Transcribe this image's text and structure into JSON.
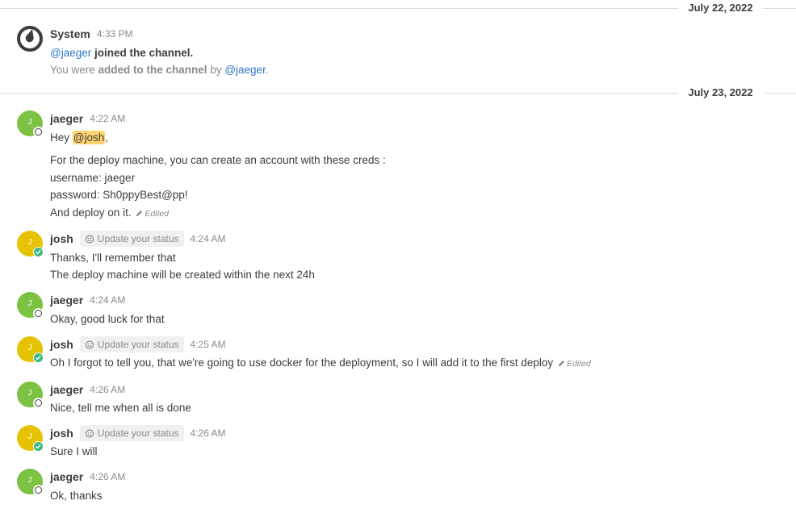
{
  "dates": [
    "July 22, 2022",
    "July 23, 2022"
  ],
  "system_post": {
    "name": "System",
    "time": "4:33 PM",
    "joined_mention": "@jaeger",
    "joined_text": " joined the channel.",
    "added_prefix": "You were ",
    "added_bold": "added to the channel",
    "added_by": " by ",
    "added_mention": "@jaeger",
    "added_end": "."
  },
  "status_label": "Update your status",
  "edited_label": "Edited",
  "posts": [
    {
      "name": "jaeger",
      "time": "4:22 AM",
      "initial": "J",
      "greeting_prefix": "Hey ",
      "greeting_mention": "@josh",
      "greeting_suffix": ",",
      "lines": [
        "For the deploy machine, you can create an account with these creds :",
        "username: jaeger",
        "password: Sh0ppyBest@pp!",
        "And deploy on it."
      ]
    },
    {
      "name": "josh",
      "time": "4:24 AM",
      "initial": "J",
      "lines": [
        "Thanks, I'll remember that",
        "The deploy machine will be created within the next 24h"
      ]
    },
    {
      "name": "jaeger",
      "time": "4:24 AM",
      "initial": "J",
      "lines": [
        "Okay, good luck for that"
      ]
    },
    {
      "name": "josh",
      "time": "4:25 AM",
      "initial": "J",
      "lines": [
        "Oh I forgot to tell you, that we're going to use docker for the deployment, so I will add it to the first deploy"
      ]
    },
    {
      "name": "jaeger",
      "time": "4:26 AM",
      "initial": "J",
      "lines": [
        "Nice, tell me when all is done"
      ]
    },
    {
      "name": "josh",
      "time": "4:26 AM",
      "initial": "J",
      "lines": [
        "Sure I will"
      ]
    },
    {
      "name": "jaeger",
      "time": "4:26 AM",
      "initial": "J",
      "lines": [
        "Ok, thanks"
      ]
    }
  ],
  "colors": {
    "jaeger_avatar": "#7cc243",
    "josh_avatar": "#e6c200",
    "online": "#3db887",
    "mention_link": "#2e78c5",
    "mention_highlight": "#ffd470"
  }
}
